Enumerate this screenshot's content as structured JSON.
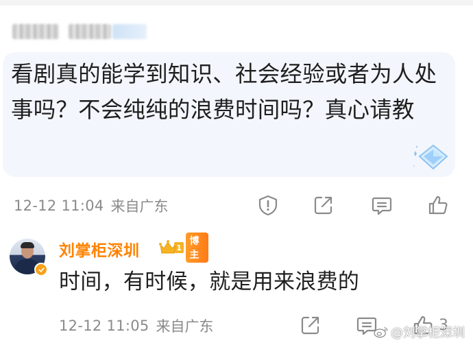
{
  "question": {
    "text": "看剧真的能学到知识、社会经验或者为人处事吗？不会纯纯的浪费时间吗？真心请教",
    "time": "12-12 11:04",
    "location": "来自广东"
  },
  "reply": {
    "author": "刘掌柜深圳",
    "vip_level": "1",
    "author_tag": "博主",
    "text": "时间，有时候，就是用来浪费的",
    "time": "12-12 11:05",
    "location": "来自广东",
    "like_count": "3"
  },
  "watermark": "@刘掌柜深圳",
  "colors": {
    "author_orange": "#ff8200",
    "meta_gray": "#8a8a8a",
    "bubble_bg": "#f3f6fc"
  },
  "icons": {
    "question_actions": [
      "report-icon",
      "share-icon",
      "comment-icon",
      "like-icon"
    ],
    "reply_actions": [
      "share-icon",
      "comment-icon",
      "like-icon"
    ]
  }
}
